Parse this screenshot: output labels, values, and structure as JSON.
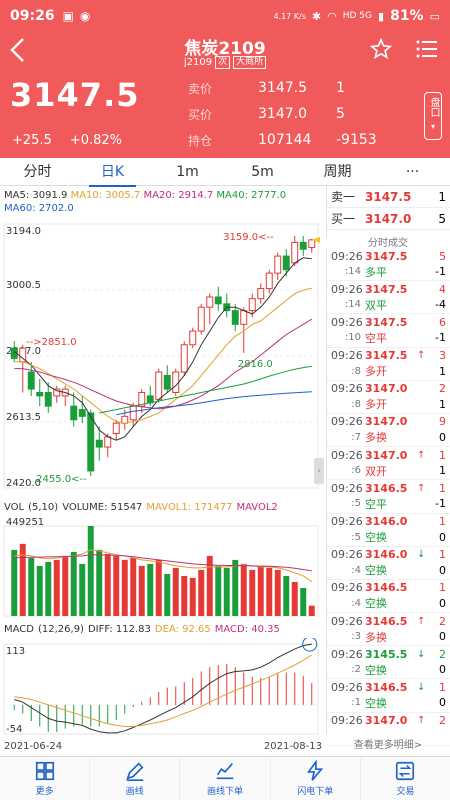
{
  "status_bar": {
    "time": "09:26",
    "speed": "4.17 K/s",
    "network": "HD 5G",
    "battery": "81%"
  },
  "header": {
    "title": "焦炭2109",
    "code": "j2109",
    "tag1": "次",
    "exchange": "大商所",
    "last_price": "3147.5",
    "change": "+25.5",
    "change_pct": "+0.82%",
    "sell_label": "卖价",
    "sell_price": "3147.5",
    "sell_vol": "1",
    "buy_label": "买价",
    "buy_price": "3147.0",
    "buy_vol": "5",
    "oi_label": "持仓",
    "open_interest": "107144",
    "oi_change": "-9153",
    "side_button": "盘口"
  },
  "tabs": [
    "分时",
    "日K",
    "1m",
    "5m",
    "周期",
    "···"
  ],
  "active_tab": 1,
  "ma_legend": {
    "ma5": "MA5: 3091.9",
    "ma10": "MA10: 3005.7",
    "ma20": "MA20: 2914.7",
    "ma40": "MA40: 2777.0",
    "ma60": "MA60: 2702.0"
  },
  "volume_legend": {
    "name": "VOL",
    "params": "(5,10)",
    "volume": "VOLUME: 51547",
    "mavol1": "MAVOL1: 171477",
    "mavol2": "MAVOL2"
  },
  "macd_legend": {
    "name": "MACD",
    "params": "(12,26,9)",
    "diff": "DIFF: 112.83",
    "dea": "DEA: 92.65",
    "macd": "MACD: 40.35"
  },
  "dates": {
    "start": "2021-06-24",
    "end": "2021-08-13"
  },
  "orderbook": [
    {
      "label": "卖一",
      "price": "3147.5",
      "vol": "1"
    },
    {
      "label": "买一",
      "price": "3147.0",
      "vol": "5"
    }
  ],
  "trades_title": "分时成交",
  "trades": [
    {
      "time": "09:26",
      "price": "3147.5",
      "arrow": "",
      "vol": "5",
      "sec": ":14",
      "kind": "多平",
      "delta": "-1",
      "pc": "red",
      "kc": "green"
    },
    {
      "time": "09:26",
      "price": "3147.5",
      "arrow": "",
      "vol": "4",
      "sec": ":14",
      "kind": "双平",
      "delta": "-4",
      "pc": "red",
      "kc": "green"
    },
    {
      "time": "09:26",
      "price": "3147.5",
      "arrow": "",
      "vol": "6",
      "sec": ":10",
      "kind": "空平",
      "delta": "-1",
      "pc": "red",
      "kc": "red"
    },
    {
      "time": "09:26",
      "price": "3147.5",
      "arrow": "↑",
      "vol": "3",
      "sec": ":8",
      "kind": "多开",
      "delta": "1",
      "pc": "red",
      "kc": "red"
    },
    {
      "time": "09:26",
      "price": "3147.0",
      "arrow": "",
      "vol": "2",
      "sec": ":8",
      "kind": "多开",
      "delta": "1",
      "pc": "red",
      "kc": "red"
    },
    {
      "time": "09:26",
      "price": "3147.0",
      "arrow": "",
      "vol": "9",
      "sec": ":7",
      "kind": "多换",
      "delta": "0",
      "pc": "red",
      "kc": "red"
    },
    {
      "time": "09:26",
      "price": "3147.0",
      "arrow": "↑",
      "vol": "1",
      "sec": ":6",
      "kind": "双开",
      "delta": "1",
      "pc": "red",
      "kc": "red"
    },
    {
      "time": "09:26",
      "price": "3146.5",
      "arrow": "↑",
      "vol": "1",
      "sec": ":5",
      "kind": "空平",
      "delta": "-1",
      "pc": "red",
      "kc": "green"
    },
    {
      "time": "09:26",
      "price": "3146.0",
      "arrow": "",
      "vol": "1",
      "sec": ":5",
      "kind": "空换",
      "delta": "0",
      "pc": "red",
      "kc": "green"
    },
    {
      "time": "09:26",
      "price": "3146.0",
      "arrow": "↓",
      "vol": "1",
      "sec": ":4",
      "kind": "空换",
      "delta": "0",
      "pc": "red",
      "kc": "green"
    },
    {
      "time": "09:26",
      "price": "3146.5",
      "arrow": "",
      "vol": "1",
      "sec": ":4",
      "kind": "空换",
      "delta": "0",
      "pc": "red",
      "kc": "green"
    },
    {
      "time": "09:26",
      "price": "3146.5",
      "arrow": "↑",
      "vol": "2",
      "sec": ":3",
      "kind": "多换",
      "delta": "0",
      "pc": "red",
      "kc": "red"
    },
    {
      "time": "09:26",
      "price": "3145.5",
      "arrow": "↓",
      "vol": "2",
      "sec": ":2",
      "kind": "空换",
      "delta": "0",
      "pc": "green",
      "kc": "green"
    },
    {
      "time": "09:26",
      "price": "3146.5",
      "arrow": "↓",
      "vol": "1",
      "sec": ":1",
      "kind": "空换",
      "delta": "0",
      "pc": "red",
      "kc": "green"
    },
    {
      "time": "09:26",
      "price": "3147.0",
      "arrow": "↑",
      "vol": "2",
      "sec": "",
      "kind": "",
      "delta": "",
      "pc": "red",
      "kc": "red"
    }
  ],
  "more_text": "查看更多明细>",
  "bottom_bar": [
    {
      "label": "更多",
      "icon": "grid-icon"
    },
    {
      "label": "画线",
      "icon": "pen-icon"
    },
    {
      "label": "画线下单",
      "icon": "pen-order-icon"
    },
    {
      "label": "闪电下单",
      "icon": "lightning-icon"
    },
    {
      "label": "交易",
      "icon": "trade-icon"
    }
  ],
  "colors": {
    "header_bg": "#f05a5a",
    "up": "#e53935",
    "down": "#1a9e3a",
    "accent": "#1e63c8"
  },
  "chart_data": {
    "type": "candlestick",
    "title": "",
    "y_axis_labels": [
      "3194.0",
      "3000.5",
      "2807.0",
      "2613.5",
      "2420.0"
    ],
    "ylim": [
      2420.0,
      3194.0
    ],
    "annotations": [
      {
        "text": "3159.0<--",
        "value": 3159.0
      },
      {
        "text": "-->2851.0",
        "value": 2851.0
      },
      {
        "text": "2816.0",
        "value": 2816.0
      },
      {
        "text": "2455.0<--",
        "value": 2455.0
      }
    ],
    "candles": [
      {
        "o": 2830,
        "h": 2851,
        "l": 2790,
        "c": 2800
      },
      {
        "o": 2790,
        "h": 2840,
        "l": 2700,
        "c": 2830
      },
      {
        "o": 2760,
        "h": 2790,
        "l": 2690,
        "c": 2710
      },
      {
        "o": 2700,
        "h": 2740,
        "l": 2660,
        "c": 2690
      },
      {
        "o": 2700,
        "h": 2730,
        "l": 2640,
        "c": 2660
      },
      {
        "o": 2690,
        "h": 2720,
        "l": 2670,
        "c": 2710
      },
      {
        "o": 2690,
        "h": 2720,
        "l": 2660,
        "c": 2710
      },
      {
        "o": 2660,
        "h": 2700,
        "l": 2600,
        "c": 2620
      },
      {
        "o": 2650,
        "h": 2690,
        "l": 2610,
        "c": 2630
      },
      {
        "o": 2640,
        "h": 2650,
        "l": 2455,
        "c": 2470
      },
      {
        "o": 2560,
        "h": 2600,
        "l": 2500,
        "c": 2540
      },
      {
        "o": 2540,
        "h": 2580,
        "l": 2510,
        "c": 2570
      },
      {
        "o": 2580,
        "h": 2620,
        "l": 2560,
        "c": 2610
      },
      {
        "o": 2610,
        "h": 2650,
        "l": 2590,
        "c": 2630
      },
      {
        "o": 2620,
        "h": 2670,
        "l": 2600,
        "c": 2660
      },
      {
        "o": 2660,
        "h": 2710,
        "l": 2640,
        "c": 2700
      },
      {
        "o": 2690,
        "h": 2720,
        "l": 2660,
        "c": 2670
      },
      {
        "o": 2680,
        "h": 2770,
        "l": 2670,
        "c": 2760
      },
      {
        "o": 2750,
        "h": 2780,
        "l": 2700,
        "c": 2710
      },
      {
        "o": 2700,
        "h": 2770,
        "l": 2690,
        "c": 2760
      },
      {
        "o": 2760,
        "h": 2850,
        "l": 2750,
        "c": 2840
      },
      {
        "o": 2840,
        "h": 2890,
        "l": 2830,
        "c": 2880
      },
      {
        "o": 2880,
        "h": 2960,
        "l": 2870,
        "c": 2950
      },
      {
        "o": 2950,
        "h": 2990,
        "l": 2900,
        "c": 2980
      },
      {
        "o": 2980,
        "h": 3010,
        "l": 2940,
        "c": 2960
      },
      {
        "o": 2960,
        "h": 2990,
        "l": 2920,
        "c": 2940
      },
      {
        "o": 2940,
        "h": 2960,
        "l": 2880,
        "c": 2900
      },
      {
        "o": 2900,
        "h": 2950,
        "l": 2816,
        "c": 2940
      },
      {
        "o": 2940,
        "h": 2990,
        "l": 2920,
        "c": 2975
      },
      {
        "o": 2975,
        "h": 3020,
        "l": 2960,
        "c": 3005
      },
      {
        "o": 3005,
        "h": 3060,
        "l": 2990,
        "c": 3050
      },
      {
        "o": 3050,
        "h": 3110,
        "l": 3030,
        "c": 3100
      },
      {
        "o": 3100,
        "h": 3120,
        "l": 3040,
        "c": 3060
      },
      {
        "o": 3080,
        "h": 3159,
        "l": 3070,
        "c": 3140
      },
      {
        "o": 3140,
        "h": 3159,
        "l": 3100,
        "c": 3120
      },
      {
        "o": 3125,
        "h": 3150,
        "l": 3110,
        "c": 3147.5
      }
    ],
    "ma_series": [
      {
        "name": "MA5",
        "color": "#333333",
        "values": [
          2820,
          2800,
          2780,
          2750,
          2720,
          2705,
          2700,
          2690,
          2670,
          2630,
          2590,
          2570,
          2560,
          2570,
          2600,
          2630,
          2650,
          2680,
          2700,
          2720,
          2750,
          2790,
          2840,
          2880,
          2920,
          2950,
          2950,
          2940,
          2930,
          2950,
          2980,
          3020,
          3050,
          3080,
          3095,
          3092
        ]
      },
      {
        "name": "MA10",
        "color": "#e0a030",
        "values": [
          2790,
          2790,
          2780,
          2770,
          2755,
          2740,
          2725,
          2710,
          2690,
          2670,
          2650,
          2630,
          2615,
          2610,
          2615,
          2620,
          2630,
          2640,
          2660,
          2680,
          2700,
          2720,
          2750,
          2780,
          2810,
          2840,
          2865,
          2880,
          2900,
          2910,
          2930,
          2950,
          2970,
          2990,
          3000,
          3006
        ]
      },
      {
        "name": "MA20",
        "color": "#c0307a",
        "values": [
          2770,
          2770,
          2765,
          2760,
          2752,
          2745,
          2738,
          2730,
          2720,
          2708,
          2697,
          2685,
          2675,
          2668,
          2662,
          2658,
          2655,
          2652,
          2655,
          2660,
          2668,
          2678,
          2690,
          2705,
          2720,
          2740,
          2760,
          2775,
          2790,
          2810,
          2830,
          2850,
          2870,
          2885,
          2900,
          2915
        ]
      },
      {
        "name": "MA40",
        "color": "#1a9e3a",
        "values": [
          null,
          null,
          null,
          null,
          null,
          null,
          null,
          null,
          null,
          null,
          2640,
          2645,
          2650,
          2655,
          2660,
          2665,
          2670,
          2675,
          2680,
          2685,
          2690,
          2695,
          2700,
          2705,
          2710,
          2715,
          2720,
          2725,
          2732,
          2740,
          2748,
          2755,
          2762,
          2768,
          2773,
          2777
        ]
      },
      {
        "name": "MA60",
        "color": "#1e63c8",
        "values": [
          null,
          null,
          null,
          null,
          null,
          null,
          null,
          null,
          null,
          null,
          null,
          null,
          2635,
          2640,
          2645,
          2648,
          2652,
          2655,
          2658,
          2660,
          2663,
          2666,
          2670,
          2674,
          2678,
          2682,
          2685,
          2688,
          2690,
          2692,
          2694,
          2696,
          2698,
          2699,
          2701,
          2702
        ]
      }
    ],
    "volume": {
      "y_axis_label": "449251",
      "values": [
        330000,
        360000,
        290000,
        250000,
        270000,
        280000,
        300000,
        320000,
        260000,
        449251,
        330000,
        310000,
        300000,
        280000,
        290000,
        250000,
        260000,
        280000,
        210000,
        240000,
        200000,
        190000,
        230000,
        300000,
        250000,
        240000,
        280000,
        260000,
        230000,
        250000,
        240000,
        230000,
        200000,
        170000,
        140000,
        51547
      ],
      "mavol1": [
        300000,
        305000,
        300000,
        290000,
        285000,
        290000,
        295000,
        300000,
        310000,
        330000,
        325000,
        315000,
        305000,
        300000,
        290000,
        280000,
        275000,
        270000,
        260000,
        250000,
        245000,
        240000,
        240000,
        245000,
        245000,
        245000,
        250000,
        255000,
        250000,
        245000,
        245000,
        240000,
        230000,
        215000,
        200000,
        171477
      ],
      "mavol2": [
        290000,
        292000,
        293000,
        294000,
        295000,
        296000,
        297000,
        298000,
        300000,
        305000,
        305000,
        304000,
        303000,
        300000,
        296000,
        290000,
        285000,
        280000,
        275000,
        270000,
        265000,
        260000,
        257000,
        255000,
        253000,
        252000,
        252000,
        251000,
        250000,
        249000,
        248000,
        246000,
        243000,
        238000,
        232000,
        225000
      ]
    },
    "macd": {
      "y_axis_labels": [
        "113",
        "-54"
      ],
      "ylim": [
        -54,
        113
      ],
      "diff": [
        10,
        5,
        -5,
        -15,
        -25,
        -30,
        -32,
        -35,
        -38,
        -45,
        -50,
        -52,
        -52,
        -48,
        -42,
        -35,
        -28,
        -20,
        -12,
        -5,
        5,
        15,
        28,
        40,
        50,
        58,
        62,
        63,
        65,
        70,
        78,
        88,
        96,
        104,
        110,
        112.83
      ],
      "dea": [
        15,
        13,
        10,
        5,
        0,
        -5,
        -10,
        -15,
        -20,
        -25,
        -30,
        -35,
        -38,
        -40,
        -40,
        -38,
        -35,
        -32,
        -28,
        -22,
        -16,
        -10,
        -3,
        5,
        13,
        20,
        27,
        33,
        39,
        45,
        52,
        59,
        66,
        74,
        83,
        92.65
      ],
      "macd": [
        -10,
        -16,
        -30,
        -40,
        -50,
        -50,
        -44,
        -40,
        -36,
        -40,
        -40,
        -34,
        -28,
        -16,
        -4,
        6,
        14,
        24,
        32,
        34,
        42,
        50,
        62,
        70,
        74,
        76,
        70,
        60,
        52,
        50,
        52,
        58,
        60,
        60,
        54,
        40.35
      ]
    }
  }
}
